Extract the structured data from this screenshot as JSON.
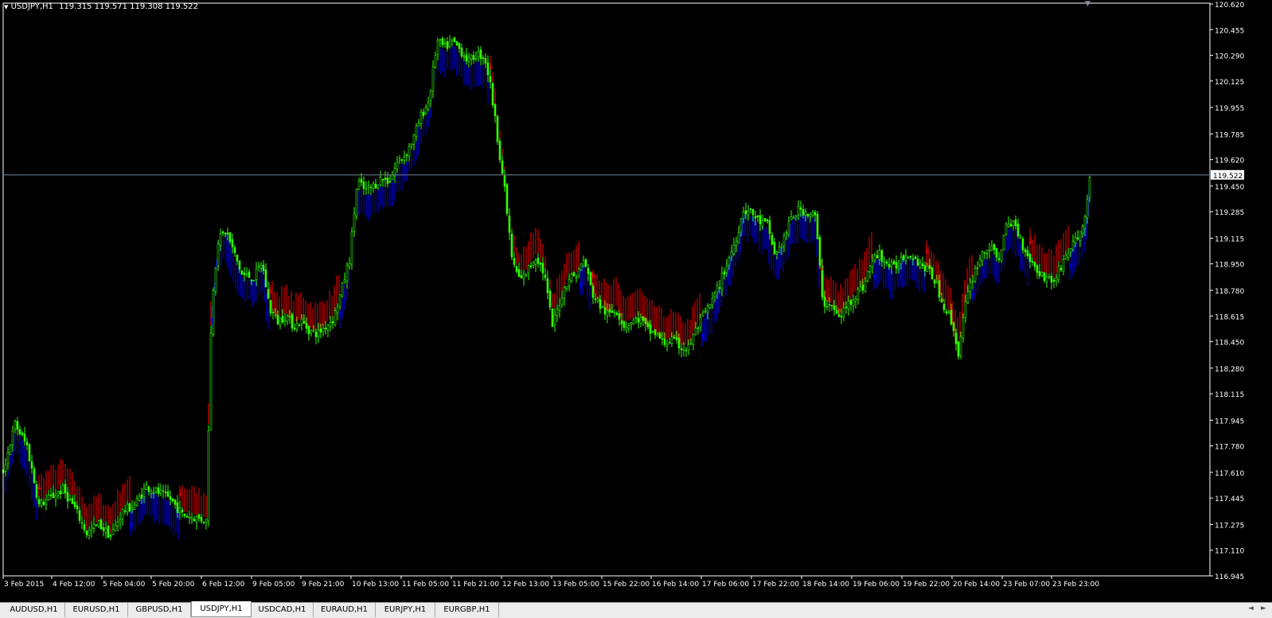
{
  "header": {
    "symbol_label": "USDJPY,H1",
    "ohlc": "119.315 119.571 119.308 119.522"
  },
  "colors": {
    "background": "#000000",
    "bull_candle": "#33ff00",
    "bear_candle": "#33ff00",
    "band_up": "#0000ff",
    "band_down": "#ff0000",
    "axis": "#ffffff",
    "bid_line": "#778899"
  },
  "chart_data": {
    "type": "candlestick",
    "price_scale": {
      "ylim": [
        116.945,
        120.62
      ],
      "ticks": [
        "120.620",
        "120.455",
        "120.290",
        "120.125",
        "119.955",
        "119.785",
        "119.620",
        "119.450",
        "119.285",
        "119.115",
        "118.950",
        "118.780",
        "118.615",
        "118.450",
        "118.280",
        "118.115",
        "117.945",
        "117.780",
        "117.610",
        "117.445",
        "117.275",
        "117.110",
        "116.945"
      ]
    },
    "time_scale": {
      "ticks": [
        "3 Feb 2015",
        "4 Feb 12:00",
        "5 Feb 04:00",
        "5 Feb 20:00",
        "6 Feb 12:00",
        "9 Feb 05:00",
        "9 Feb 21:00",
        "10 Feb 13:00",
        "11 Feb 05:00",
        "11 Feb 21:00",
        "12 Feb 13:00",
        "13 Feb 05:00",
        "15 Feb 22:00",
        "16 Feb 14:00",
        "17 Feb 06:00",
        "17 Feb 22:00",
        "18 Feb 14:00",
        "19 Feb 06:00",
        "19 Feb 22:00",
        "20 Feb 14:00",
        "23 Feb 07:00",
        "23 Feb 23:00"
      ]
    },
    "current_price": "119.522",
    "price_path": [
      [
        0,
        117.62
      ],
      [
        15,
        117.92
      ],
      [
        30,
        117.78
      ],
      [
        45,
        117.4
      ],
      [
        60,
        117.45
      ],
      [
        75,
        117.5
      ],
      [
        90,
        117.38
      ],
      [
        105,
        117.22
      ],
      [
        120,
        117.28
      ],
      [
        135,
        117.2
      ],
      [
        150,
        117.36
      ],
      [
        165,
        117.4
      ],
      [
        180,
        117.52
      ],
      [
        195,
        117.48
      ],
      [
        210,
        117.44
      ],
      [
        225,
        117.34
      ],
      [
        240,
        117.32
      ],
      [
        255,
        117.3
      ],
      [
        262,
        118.7
      ],
      [
        270,
        119.1
      ],
      [
        280,
        119.16
      ],
      [
        290,
        119.02
      ],
      [
        300,
        118.88
      ],
      [
        315,
        118.86
      ],
      [
        325,
        118.96
      ],
      [
        335,
        118.66
      ],
      [
        345,
        118.58
      ],
      [
        355,
        118.62
      ],
      [
        365,
        118.55
      ],
      [
        375,
        118.58
      ],
      [
        385,
        118.52
      ],
      [
        395,
        118.5
      ],
      [
        405,
        118.55
      ],
      [
        415,
        118.6
      ],
      [
        425,
        118.78
      ],
      [
        435,
        118.98
      ],
      [
        445,
        119.48
      ],
      [
        455,
        119.42
      ],
      [
        465,
        119.45
      ],
      [
        475,
        119.5
      ],
      [
        485,
        119.48
      ],
      [
        495,
        119.6
      ],
      [
        505,
        119.65
      ],
      [
        515,
        119.75
      ],
      [
        525,
        119.9
      ],
      [
        535,
        120.0
      ],
      [
        545,
        120.38
      ],
      [
        555,
        120.34
      ],
      [
        565,
        120.38
      ],
      [
        575,
        120.32
      ],
      [
        585,
        120.25
      ],
      [
        595,
        120.3
      ],
      [
        605,
        120.28
      ],
      [
        612,
        120.1
      ],
      [
        620,
        119.8
      ],
      [
        630,
        119.42
      ],
      [
        640,
        118.95
      ],
      [
        650,
        118.84
      ],
      [
        660,
        118.92
      ],
      [
        670,
        119.0
      ],
      [
        680,
        118.88
      ],
      [
        690,
        118.55
      ],
      [
        700,
        118.72
      ],
      [
        710,
        118.86
      ],
      [
        720,
        118.88
      ],
      [
        730,
        118.98
      ],
      [
        740,
        118.76
      ],
      [
        750,
        118.68
      ],
      [
        760,
        118.62
      ],
      [
        770,
        118.66
      ],
      [
        780,
        118.55
      ],
      [
        790,
        118.58
      ],
      [
        800,
        118.6
      ],
      [
        810,
        118.52
      ],
      [
        820,
        118.5
      ],
      [
        830,
        118.44
      ],
      [
        840,
        118.46
      ],
      [
        850,
        118.42
      ],
      [
        860,
        118.4
      ],
      [
        870,
        118.52
      ],
      [
        880,
        118.62
      ],
      [
        890,
        118.7
      ],
      [
        900,
        118.82
      ],
      [
        910,
        118.96
      ],
      [
        920,
        119.1
      ],
      [
        930,
        119.3
      ],
      [
        940,
        119.28
      ],
      [
        950,
        119.22
      ],
      [
        960,
        119.2
      ],
      [
        970,
        119.0
      ],
      [
        980,
        119.1
      ],
      [
        990,
        119.24
      ],
      [
        1000,
        119.3
      ],
      [
        1010,
        119.28
      ],
      [
        1020,
        119.26
      ],
      [
        1030,
        118.7
      ],
      [
        1040,
        118.68
      ],
      [
        1050,
        118.6
      ],
      [
        1060,
        118.68
      ],
      [
        1070,
        118.75
      ],
      [
        1080,
        118.8
      ],
      [
        1090,
        118.95
      ],
      [
        1100,
        119.02
      ],
      [
        1110,
        118.95
      ],
      [
        1120,
        118.92
      ],
      [
        1130,
        119.0
      ],
      [
        1140,
        119.02
      ],
      [
        1150,
        118.96
      ],
      [
        1160,
        118.92
      ],
      [
        1170,
        118.85
      ],
      [
        1180,
        118.7
      ],
      [
        1190,
        118.6
      ],
      [
        1200,
        118.38
      ],
      [
        1210,
        118.72
      ],
      [
        1220,
        118.9
      ],
      [
        1230,
        119.02
      ],
      [
        1240,
        119.05
      ],
      [
        1250,
        118.98
      ],
      [
        1260,
        119.18
      ],
      [
        1270,
        119.22
      ],
      [
        1280,
        119.08
      ],
      [
        1290,
        118.98
      ],
      [
        1300,
        118.9
      ],
      [
        1310,
        118.86
      ],
      [
        1320,
        118.84
      ],
      [
        1330,
        118.95
      ],
      [
        1340,
        119.05
      ],
      [
        1350,
        119.12
      ],
      [
        1360,
        119.25
      ],
      [
        1365,
        119.52
      ]
    ],
    "band_segments": [
      {
        "direction": "up",
        "from": 0,
        "to": 45
      },
      {
        "direction": "down",
        "from": 45,
        "to": 160
      },
      {
        "direction": "up",
        "from": 160,
        "to": 222
      },
      {
        "direction": "down",
        "from": 222,
        "to": 262
      },
      {
        "direction": "up",
        "from": 262,
        "to": 335
      },
      {
        "direction": "down",
        "from": 335,
        "to": 423
      },
      {
        "direction": "up",
        "from": 423,
        "to": 612
      },
      {
        "direction": "down",
        "from": 612,
        "to": 725
      },
      {
        "direction": "up",
        "from": 725,
        "to": 740
      },
      {
        "direction": "down",
        "from": 740,
        "to": 878
      },
      {
        "direction": "up",
        "from": 878,
        "to": 1028
      },
      {
        "direction": "down",
        "from": 1028,
        "to": 1094
      },
      {
        "direction": "up",
        "from": 1094,
        "to": 1160
      },
      {
        "direction": "down",
        "from": 1160,
        "to": 1218
      },
      {
        "direction": "up",
        "from": 1218,
        "to": 1290
      },
      {
        "direction": "down",
        "from": 1290,
        "to": 1340
      },
      {
        "direction": "up",
        "from": 1340,
        "to": 1365
      }
    ]
  },
  "symbol_tabs": [
    "AUDUSD,H1",
    "EURUSD,H1",
    "GBPUSD,H1",
    "USDJPY,H1",
    "USDCAD,H1",
    "EURAUD,H1",
    "EURJPY,H1",
    "EURGBP,H1"
  ],
  "active_tab": 3,
  "tab_scroll": {
    "left_icon": "triangle-left-icon",
    "right_icon": "triangle-right-icon"
  }
}
